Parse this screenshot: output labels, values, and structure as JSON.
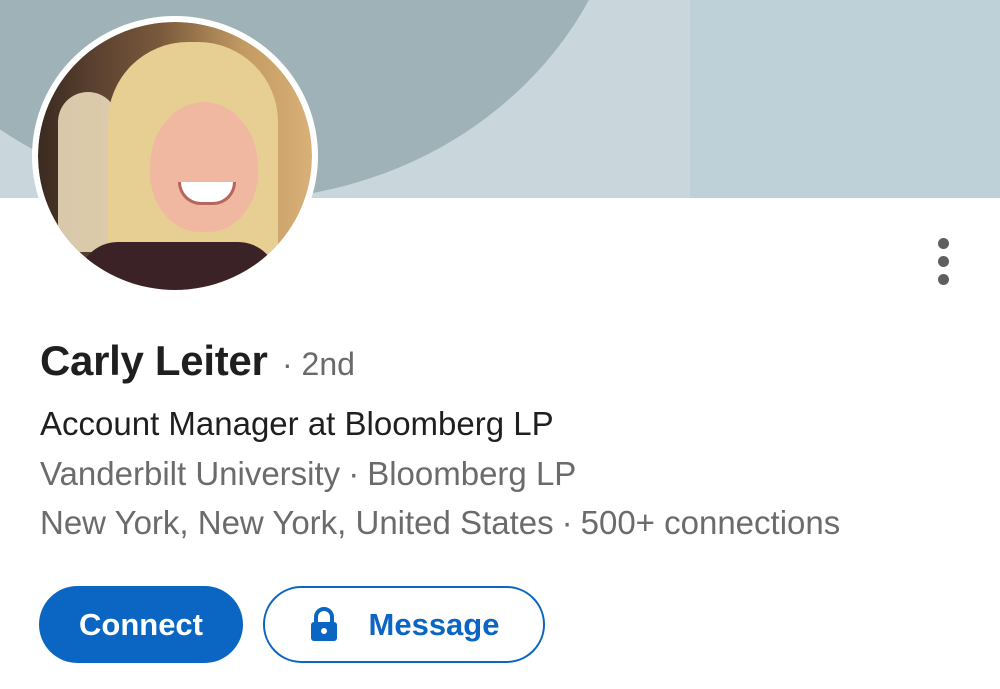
{
  "profile": {
    "name": "Carly Leiter",
    "degree": "2nd",
    "headline": "Account Manager at Bloomberg LP",
    "education": "Vanderbilt University",
    "company": "Bloomberg LP",
    "location": "New York, New York, United States",
    "connections": "500+ connections",
    "separator": "·"
  },
  "actions": {
    "connect_label": "Connect",
    "message_label": "Message"
  },
  "icons": {
    "more": "more-vertical-icon",
    "lock": "lock-icon"
  },
  "colors": {
    "accent": "#0a66c2",
    "banner_dark": "#9fb2b8",
    "banner_light": "#c9d7dc"
  }
}
